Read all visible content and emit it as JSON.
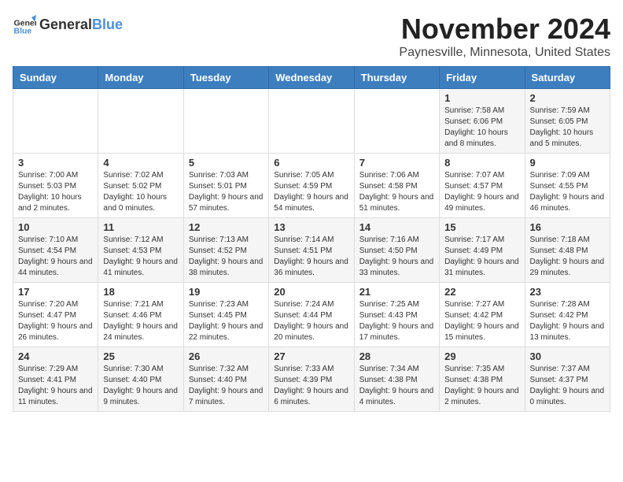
{
  "header": {
    "logo_general": "General",
    "logo_blue": "Blue",
    "month_title": "November 2024",
    "location": "Paynesville, Minnesota, United States"
  },
  "days_of_week": [
    "Sunday",
    "Monday",
    "Tuesday",
    "Wednesday",
    "Thursday",
    "Friday",
    "Saturday"
  ],
  "weeks": [
    [
      {
        "day": "",
        "info": ""
      },
      {
        "day": "",
        "info": ""
      },
      {
        "day": "",
        "info": ""
      },
      {
        "day": "",
        "info": ""
      },
      {
        "day": "",
        "info": ""
      },
      {
        "day": "1",
        "info": "Sunrise: 7:58 AM\nSunset: 6:06 PM\nDaylight: 10 hours and 8 minutes."
      },
      {
        "day": "2",
        "info": "Sunrise: 7:59 AM\nSunset: 6:05 PM\nDaylight: 10 hours and 5 minutes."
      }
    ],
    [
      {
        "day": "3",
        "info": "Sunrise: 7:00 AM\nSunset: 5:03 PM\nDaylight: 10 hours and 2 minutes."
      },
      {
        "day": "4",
        "info": "Sunrise: 7:02 AM\nSunset: 5:02 PM\nDaylight: 10 hours and 0 minutes."
      },
      {
        "day": "5",
        "info": "Sunrise: 7:03 AM\nSunset: 5:01 PM\nDaylight: 9 hours and 57 minutes."
      },
      {
        "day": "6",
        "info": "Sunrise: 7:05 AM\nSunset: 4:59 PM\nDaylight: 9 hours and 54 minutes."
      },
      {
        "day": "7",
        "info": "Sunrise: 7:06 AM\nSunset: 4:58 PM\nDaylight: 9 hours and 51 minutes."
      },
      {
        "day": "8",
        "info": "Sunrise: 7:07 AM\nSunset: 4:57 PM\nDaylight: 9 hours and 49 minutes."
      },
      {
        "day": "9",
        "info": "Sunrise: 7:09 AM\nSunset: 4:55 PM\nDaylight: 9 hours and 46 minutes."
      }
    ],
    [
      {
        "day": "10",
        "info": "Sunrise: 7:10 AM\nSunset: 4:54 PM\nDaylight: 9 hours and 44 minutes."
      },
      {
        "day": "11",
        "info": "Sunrise: 7:12 AM\nSunset: 4:53 PM\nDaylight: 9 hours and 41 minutes."
      },
      {
        "day": "12",
        "info": "Sunrise: 7:13 AM\nSunset: 4:52 PM\nDaylight: 9 hours and 38 minutes."
      },
      {
        "day": "13",
        "info": "Sunrise: 7:14 AM\nSunset: 4:51 PM\nDaylight: 9 hours and 36 minutes."
      },
      {
        "day": "14",
        "info": "Sunrise: 7:16 AM\nSunset: 4:50 PM\nDaylight: 9 hours and 33 minutes."
      },
      {
        "day": "15",
        "info": "Sunrise: 7:17 AM\nSunset: 4:49 PM\nDaylight: 9 hours and 31 minutes."
      },
      {
        "day": "16",
        "info": "Sunrise: 7:18 AM\nSunset: 4:48 PM\nDaylight: 9 hours and 29 minutes."
      }
    ],
    [
      {
        "day": "17",
        "info": "Sunrise: 7:20 AM\nSunset: 4:47 PM\nDaylight: 9 hours and 26 minutes."
      },
      {
        "day": "18",
        "info": "Sunrise: 7:21 AM\nSunset: 4:46 PM\nDaylight: 9 hours and 24 minutes."
      },
      {
        "day": "19",
        "info": "Sunrise: 7:23 AM\nSunset: 4:45 PM\nDaylight: 9 hours and 22 minutes."
      },
      {
        "day": "20",
        "info": "Sunrise: 7:24 AM\nSunset: 4:44 PM\nDaylight: 9 hours and 20 minutes."
      },
      {
        "day": "21",
        "info": "Sunrise: 7:25 AM\nSunset: 4:43 PM\nDaylight: 9 hours and 17 minutes."
      },
      {
        "day": "22",
        "info": "Sunrise: 7:27 AM\nSunset: 4:42 PM\nDaylight: 9 hours and 15 minutes."
      },
      {
        "day": "23",
        "info": "Sunrise: 7:28 AM\nSunset: 4:42 PM\nDaylight: 9 hours and 13 minutes."
      }
    ],
    [
      {
        "day": "24",
        "info": "Sunrise: 7:29 AM\nSunset: 4:41 PM\nDaylight: 9 hours and 11 minutes."
      },
      {
        "day": "25",
        "info": "Sunrise: 7:30 AM\nSunset: 4:40 PM\nDaylight: 9 hours and 9 minutes."
      },
      {
        "day": "26",
        "info": "Sunrise: 7:32 AM\nSunset: 4:40 PM\nDaylight: 9 hours and 7 minutes."
      },
      {
        "day": "27",
        "info": "Sunrise: 7:33 AM\nSunset: 4:39 PM\nDaylight: 9 hours and 6 minutes."
      },
      {
        "day": "28",
        "info": "Sunrise: 7:34 AM\nSunset: 4:38 PM\nDaylight: 9 hours and 4 minutes."
      },
      {
        "day": "29",
        "info": "Sunrise: 7:35 AM\nSunset: 4:38 PM\nDaylight: 9 hours and 2 minutes."
      },
      {
        "day": "30",
        "info": "Sunrise: 7:37 AM\nSunset: 4:37 PM\nDaylight: 9 hours and 0 minutes."
      }
    ]
  ]
}
